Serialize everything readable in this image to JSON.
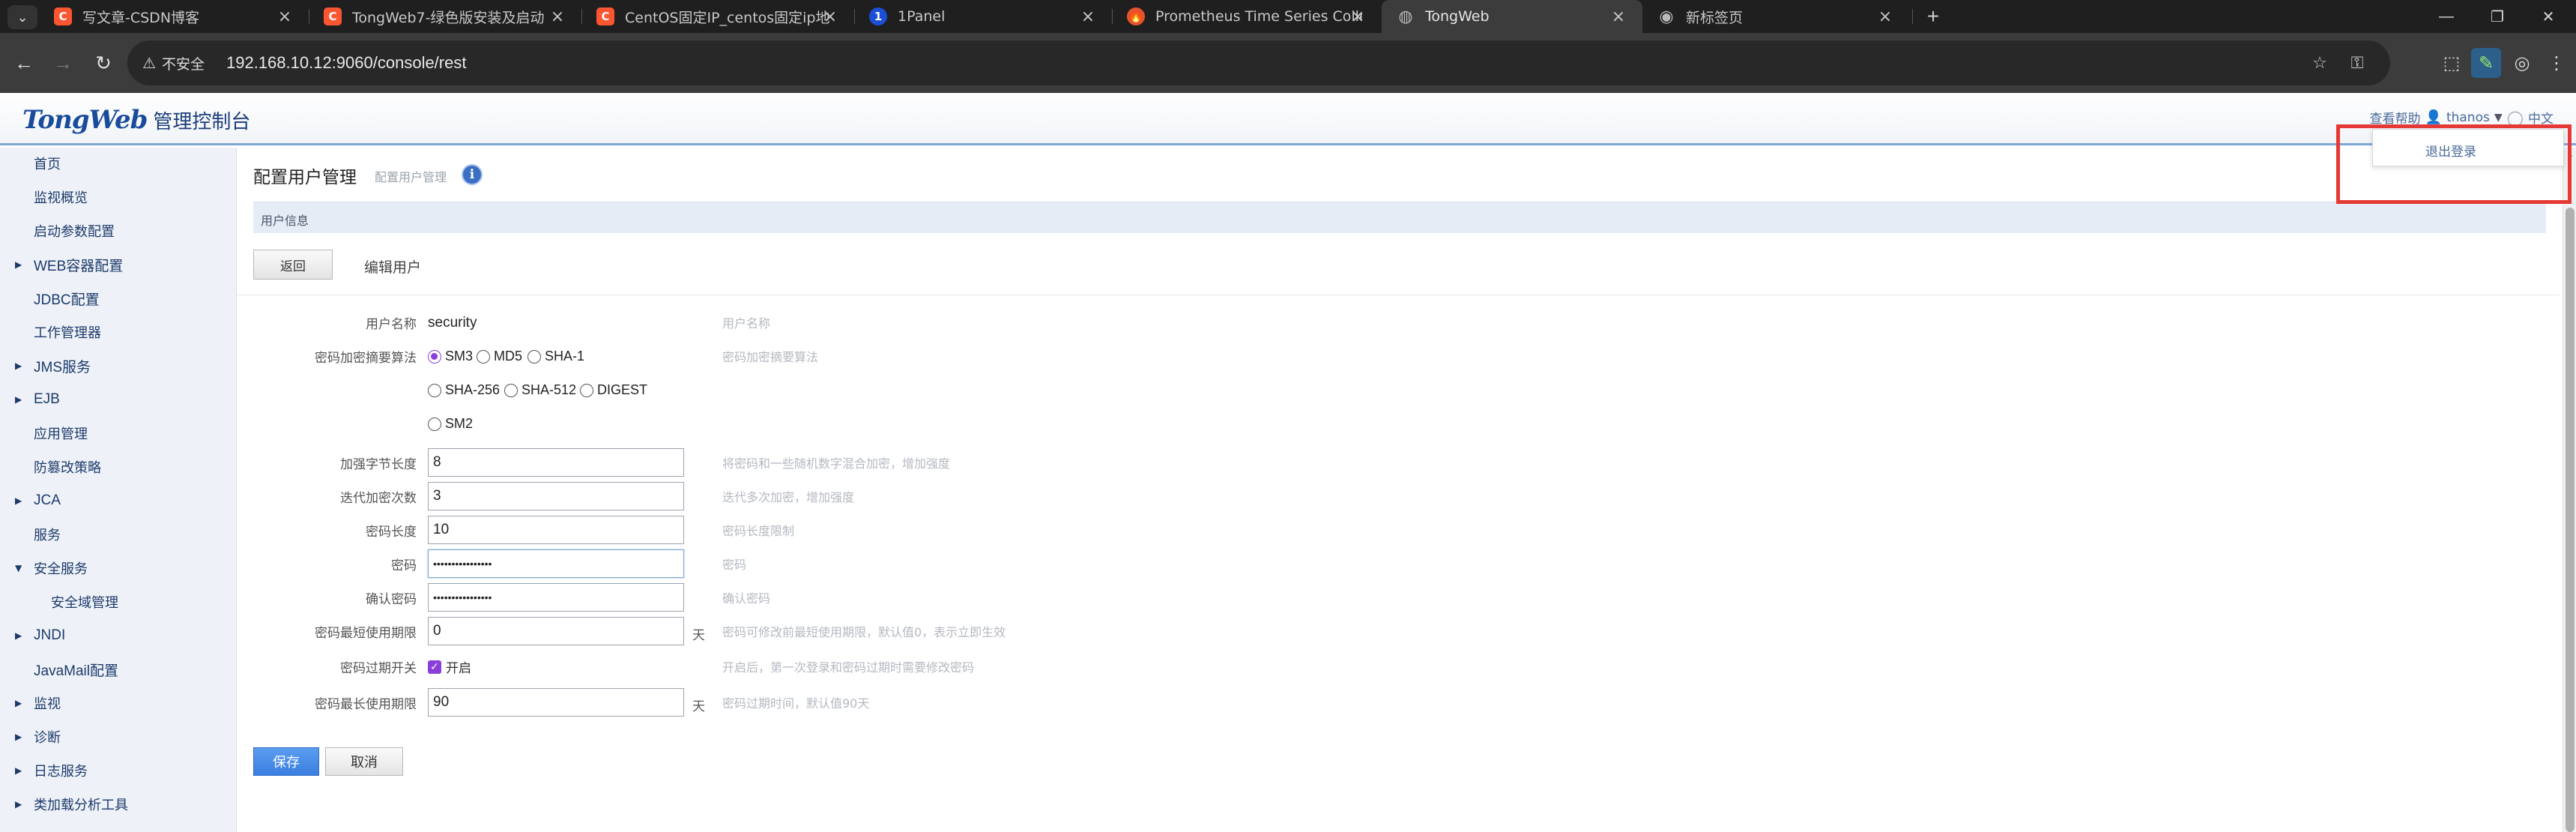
{
  "browser": {
    "tabs": [
      {
        "title": "写文章-CSDN博客",
        "icon": "csdn-icon",
        "active": false
      },
      {
        "title": "TongWeb7-绿色版安装及启动",
        "icon": "csdn-icon",
        "active": false
      },
      {
        "title": "CentOS固定IP_centos固定ip地",
        "icon": "csdn-icon",
        "active": false
      },
      {
        "title": "1Panel",
        "icon": "1panel-icon",
        "active": false
      },
      {
        "title": "Prometheus Time Series Colle",
        "icon": "prometheus-icon",
        "active": false
      },
      {
        "title": "TongWeb",
        "icon": "globe-icon",
        "active": true
      },
      {
        "title": "新标签页",
        "icon": "chrome-icon",
        "active": false
      }
    ],
    "address": {
      "security_label": "不安全",
      "url": "192.168.10.12:9060/console/rest"
    }
  },
  "header": {
    "brand": "TongWeb",
    "brand_subtitle": "管理控制台",
    "help_link": "查看帮助",
    "username": "thanos",
    "language": "中文"
  },
  "user_menu": {
    "logout": "退出登录"
  },
  "sidebar": {
    "items": [
      {
        "label": "首页",
        "expandable": false,
        "child": false
      },
      {
        "label": "监视概览",
        "expandable": false,
        "child": false
      },
      {
        "label": "启动参数配置",
        "expandable": false,
        "child": false
      },
      {
        "label": "WEB容器配置",
        "expandable": true,
        "child": false
      },
      {
        "label": "JDBC配置",
        "expandable": false,
        "child": false
      },
      {
        "label": "工作管理器",
        "expandable": false,
        "child": false
      },
      {
        "label": "JMS服务",
        "expandable": true,
        "child": false
      },
      {
        "label": "EJB",
        "expandable": true,
        "child": false
      },
      {
        "label": "应用管理",
        "expandable": false,
        "child": false
      },
      {
        "label": "防篡改策略",
        "expandable": false,
        "child": false
      },
      {
        "label": "JCA",
        "expandable": true,
        "child": false
      },
      {
        "label": "服务",
        "expandable": false,
        "child": false
      },
      {
        "label": "安全服务",
        "expandable": true,
        "expanded": true,
        "child": false
      },
      {
        "label": "安全域管理",
        "expandable": false,
        "child": true
      },
      {
        "label": "JNDI",
        "expandable": true,
        "child": false
      },
      {
        "label": "JavaMail配置",
        "expandable": false,
        "child": false
      },
      {
        "label": "监视",
        "expandable": true,
        "child": false
      },
      {
        "label": "诊断",
        "expandable": true,
        "child": false
      },
      {
        "label": "日志服务",
        "expandable": true,
        "child": false
      },
      {
        "label": "类加载分析工具",
        "expandable": true,
        "child": false
      }
    ]
  },
  "page": {
    "title": "配置用户管理",
    "breadcrumb": "配置用户管理",
    "info_icon": "i",
    "section": "用户信息",
    "back_button": "返回",
    "subtitle": "编辑用户"
  },
  "form": {
    "username": {
      "label": "用户名称",
      "value": "security",
      "help": "用户名称"
    },
    "algorithm": {
      "label": "密码加密摘要算法",
      "help": "密码加密摘要算法",
      "options": [
        "SM3",
        "MD5",
        "SHA-1",
        "SHA-256",
        "SHA-512",
        "DIGEST",
        "SM2"
      ],
      "selected": "SM3"
    },
    "salt_length": {
      "label": "加强字节长度",
      "value": "8",
      "help": "将密码和一些随机数字混合加密，增加强度"
    },
    "iterations": {
      "label": "迭代加密次数",
      "value": "3",
      "help": "迭代多次加密，增加强度"
    },
    "password_length": {
      "label": "密码长度",
      "value": "10",
      "help": "密码长度限制"
    },
    "password": {
      "label": "密码",
      "value": "••••••••••••••••",
      "help": "密码"
    },
    "confirm_password": {
      "label": "确认密码",
      "value": "••••••••••••••••",
      "help": "确认密码"
    },
    "min_age": {
      "label": "密码最短使用期限",
      "value": "0",
      "unit": "天",
      "help": "密码可修改前最短使用期限，默认值0，表示立即生效"
    },
    "expiry_switch": {
      "label": "密码过期开关",
      "checkbox_label": "开启",
      "checked": true,
      "help": "开启后，第一次登录和密码过期时需要修改密码"
    },
    "max_age": {
      "label": "密码最长使用期限",
      "value": "90",
      "unit": "天",
      "help": "密码过期时间，默认值90天"
    },
    "save_button": "保存",
    "cancel_button": "取消"
  },
  "colors": {
    "accent": "#3a7ee0",
    "highlight": "#e53935",
    "sidebar_bg": "#eef2f8",
    "radio_checked": "#8b3fd9"
  }
}
